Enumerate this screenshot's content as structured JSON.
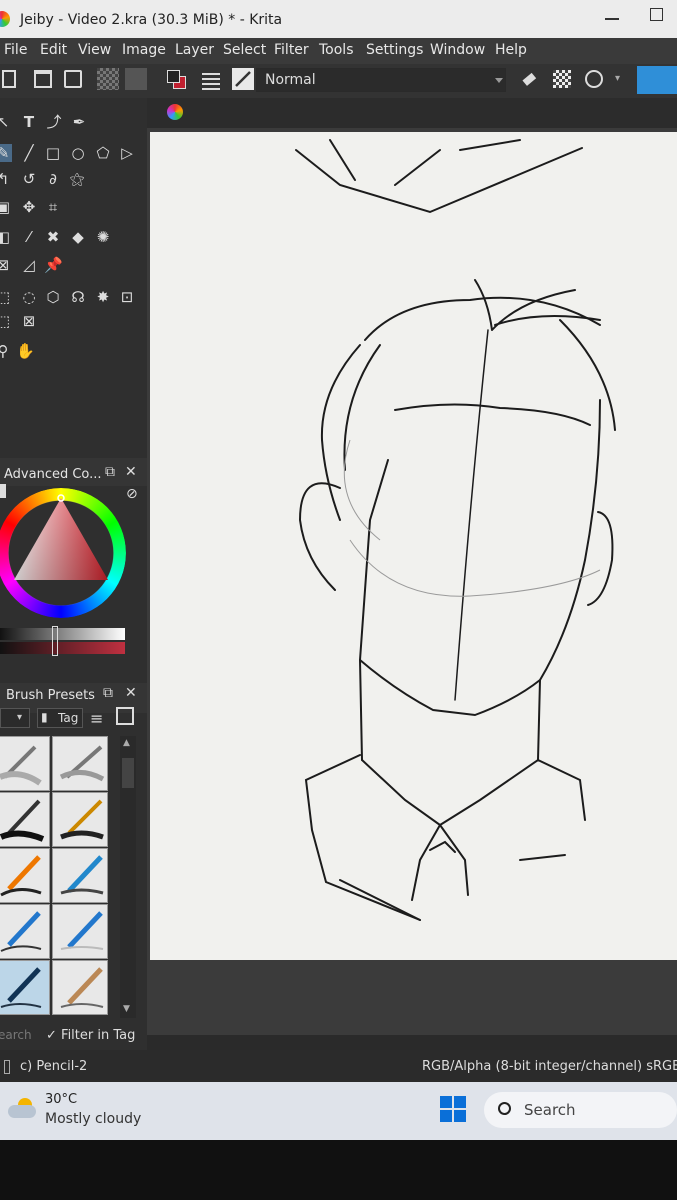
{
  "window": {
    "title": "Jeiby - Video 2.kra (30.3 MiB) * - Krita"
  },
  "menu": [
    "File",
    "Edit",
    "View",
    "Image",
    "Layer",
    "Select",
    "Filter",
    "Tools",
    "Settings",
    "Window",
    "Help"
  ],
  "toolbar": {
    "blend_mode": "Normal"
  },
  "dockers": {
    "color": {
      "title": "Advanced Co..."
    },
    "brush_presets": {
      "title": "Brush Presets",
      "tag_label": "Tag",
      "search_placeholder": "earch",
      "filter_label": "Filter in Tag"
    }
  },
  "status": {
    "brush_name": "c) Pencil-2",
    "color_space": "RGB/Alpha (8-bit integer/channel)  sRGB-"
  },
  "taskbar": {
    "temperature": "30°C",
    "weather": "Mostly cloudy",
    "search": "Search"
  },
  "colors": {
    "accent": "#2f8fd8",
    "menubar": "#3a3a3a",
    "paper": "#f1f1ee"
  }
}
